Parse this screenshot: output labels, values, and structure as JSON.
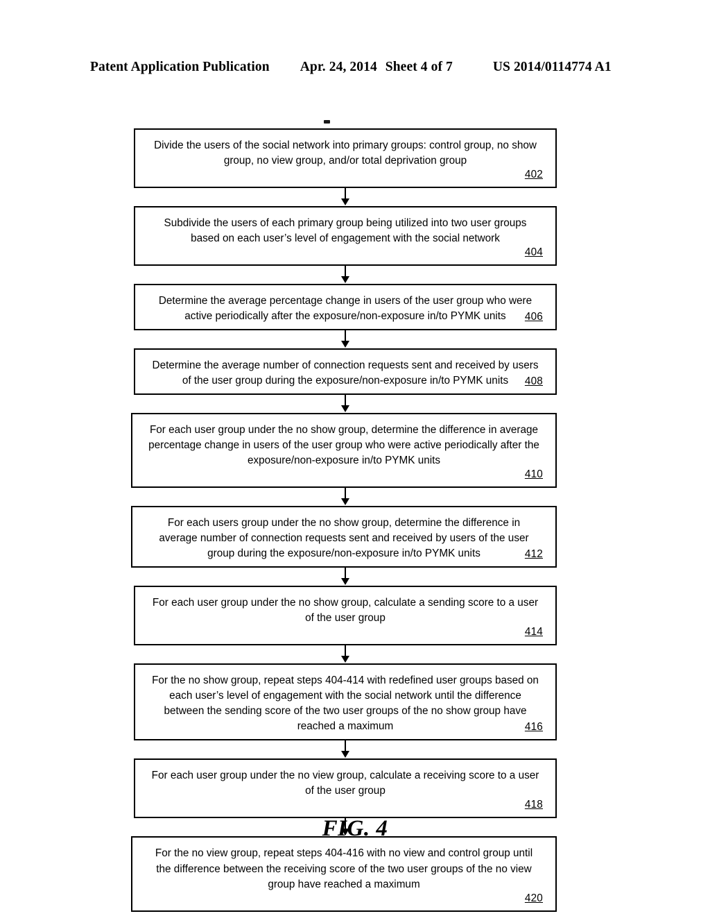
{
  "header": {
    "publication": "Patent Application Publication",
    "date": "Apr. 24, 2014",
    "sheet": "Sheet 4 of 7",
    "patent_number": "US 2014/0114774 A1"
  },
  "figure": {
    "caption": "FIG. 4"
  },
  "flowchart": {
    "steps": [
      {
        "ref": "402",
        "text": "Divide the users of the social network into primary groups:  control group, no show\ngroup, no view group, and/or total deprivation group"
      },
      {
        "ref": "404",
        "text": "Subdivide the users of each primary group being utilized into two user groups\nbased on each user’s level of engagement with the social network"
      },
      {
        "ref": "406",
        "text": "Determine the average percentage change in users of the user group who were\nactive periodically after the exposure/non-exposure in/to PYMK units"
      },
      {
        "ref": "408",
        "text": "Determine the average number of connection requests sent and received by users\nof the user group during the exposure/non-exposure in/to PYMK units"
      },
      {
        "ref": "410",
        "text": "For each user group under the no show group, determine the difference in average\npercentage change in users of the user group who were active periodically after the\nexposure/non-exposure in/to PYMK units"
      },
      {
        "ref": "412",
        "text": "For each users group under the no show group, determine the difference in\naverage number of connection requests sent and received by users of the user\ngroup during the exposure/non-exposure in/to PYMK units"
      },
      {
        "ref": "414",
        "text": "For each user group under the no show group, calculate a sending score to a user\nof the user group"
      },
      {
        "ref": "416",
        "text": "For the no show group, repeat steps 404-414 with redefined user groups based on\neach user’s level of engagement with the social network until the difference\nbetween the sending score of the two user groups of the no show group have\nreached a maximum"
      },
      {
        "ref": "418",
        "text": "For each user group under the no view group, calculate a receiving score to a user\nof the user group"
      },
      {
        "ref": "420",
        "text": "For the no view group, repeat steps 404-416 with no view and control group until\nthe difference between the receiving score of the two user groups of the no view\ngroup have reached a maximum"
      }
    ]
  }
}
